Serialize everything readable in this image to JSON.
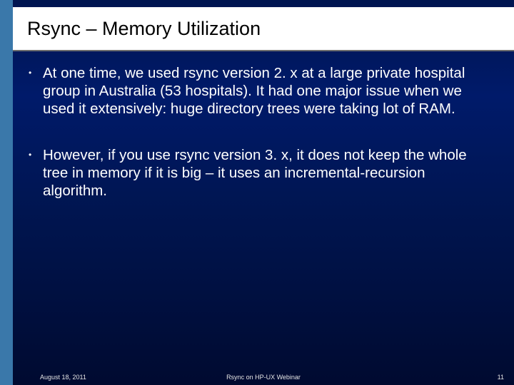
{
  "title": "Rsync – Memory Utilization",
  "bullets": [
    "At one time, we used rsync version 2. x at a large private hospital group in Australia (53 hospitals).  It had one major issue when we used it extensively: huge directory trees were taking lot of RAM.",
    "However, if you use rsync version 3. x, it does not keep the whole tree in memory if it is big – it uses an incremental-recursion algorithm."
  ],
  "footer": {
    "date": "August 18, 2011",
    "center": "Rsync on HP-UX Webinar",
    "page": "11"
  }
}
